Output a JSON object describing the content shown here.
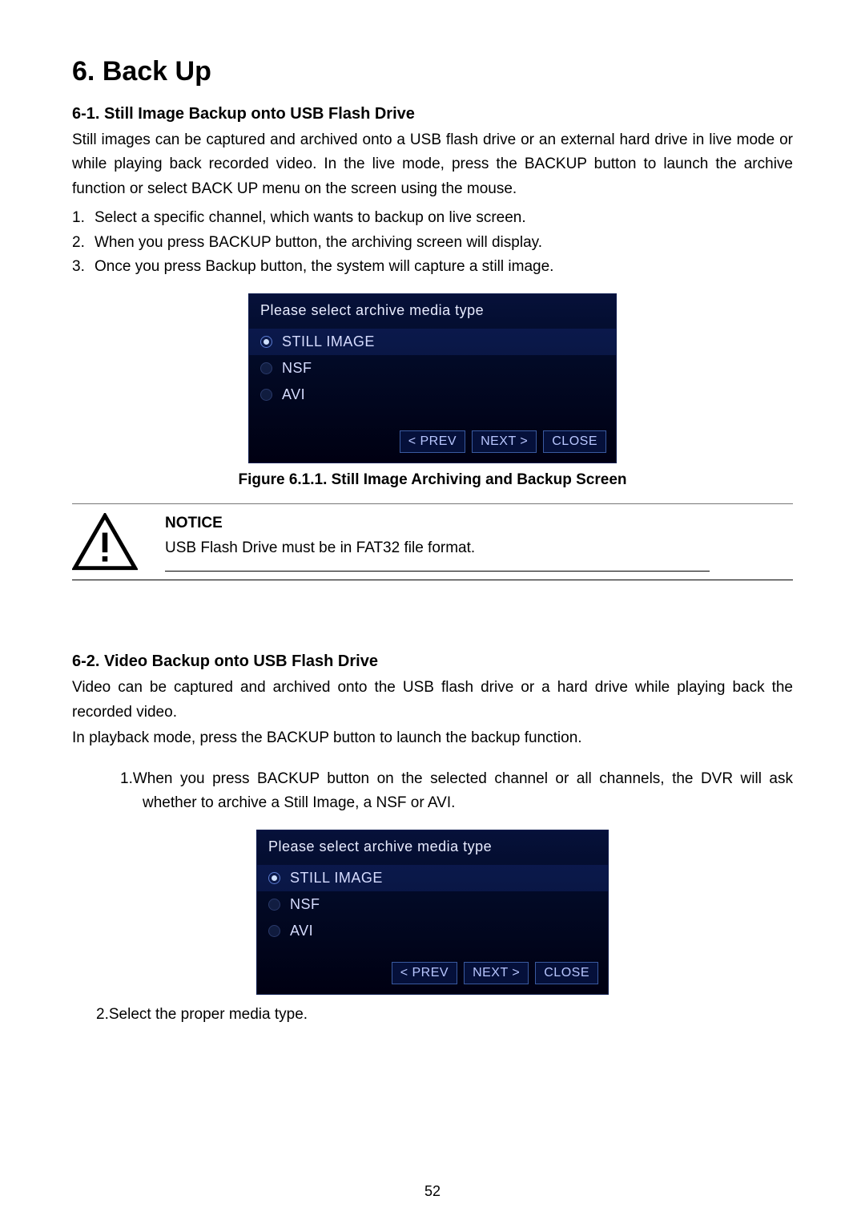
{
  "chapter": {
    "number": "6.",
    "title": "Back Up"
  },
  "section1": {
    "heading": "6-1. Still Image Backup onto USB Flash Drive",
    "para": "Still images can be captured and archived onto a USB flash drive or an external hard drive in live mode or while playing back recorded video. In the live mode, press the BACKUP button to launch the archive function or select BACK UP menu on the screen using the mouse.",
    "list": [
      "Select a specific channel, which wants to backup on live screen.",
      "When you press BACKUP button, the archiving screen will display.",
      "Once you press Backup button, the system will capture a still image."
    ]
  },
  "dialog": {
    "title": "Please select archive media type",
    "options": [
      "STILL IMAGE",
      "NSF",
      "AVI"
    ],
    "buttons": {
      "prev": "< PREV",
      "next": "NEXT >",
      "close": "CLOSE"
    }
  },
  "figure_caption": "Figure 6.1.1. Still Image Archiving and Backup Screen",
  "notice": {
    "heading": "NOTICE",
    "body": "USB Flash Drive must be in FAT32 file format."
  },
  "section2": {
    "heading": "6-2. Video Backup onto USB Flash Drive",
    "para1": "Video can be captured and archived onto the USB flash drive or a hard drive while playing back the recorded video.",
    "para2": "In playback mode, press the BACKUP button to launch the backup function.",
    "list": [
      "When you press BACKUP button on the selected channel or all channels, the DVR will ask whether to archive a Still Image, a NSF or AVI.",
      "Select the proper media type."
    ]
  },
  "page_number": "52"
}
